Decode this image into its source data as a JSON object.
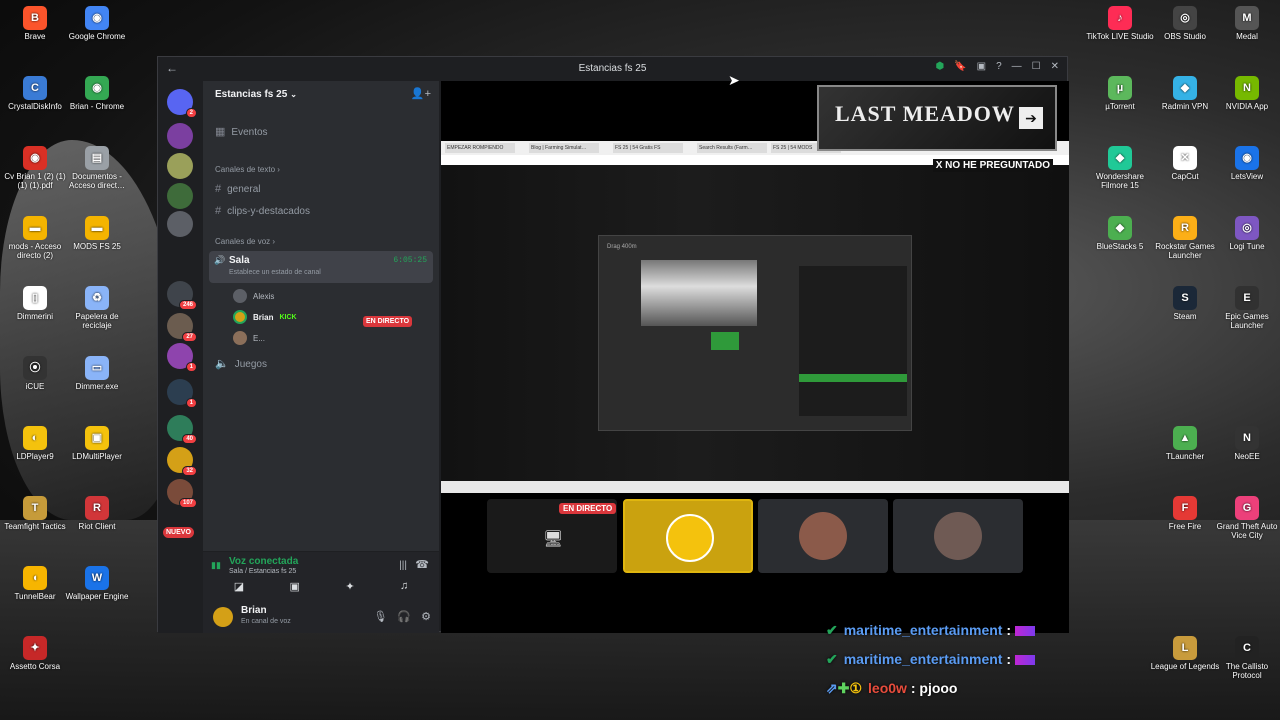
{
  "desktop": {
    "left_icons": [
      {
        "label": "Brave",
        "color": "#fb542b",
        "glyph": "B"
      },
      {
        "label": "Google Chrome",
        "color": "#4285f4",
        "glyph": "◉"
      },
      {
        "label": "CrystalDiskInfo",
        "color": "#3a7bd5",
        "glyph": "C"
      },
      {
        "label": "Brian - Chrome",
        "color": "#34a853",
        "glyph": "◉"
      },
      {
        "label": "Cv Brian 1 (2) (1) (1) (1).pdf",
        "color": "#d93025",
        "glyph": "◉"
      },
      {
        "label": "Documentos - Acceso direct…",
        "color": "#9aa0a6",
        "glyph": "▤"
      },
      {
        "label": "mods - Acceso directo (2)",
        "color": "#f4b400",
        "glyph": "▬"
      },
      {
        "label": "MODS FS 25",
        "color": "#f4b400",
        "glyph": "▬"
      },
      {
        "label": "Dimmerini",
        "color": "#ffffff",
        "glyph": "▯"
      },
      {
        "label": "Papelera de reciclaje",
        "color": "#8ab4f8",
        "glyph": "♻"
      },
      {
        "label": "iCUE",
        "color": "#333333",
        "glyph": "⦿"
      },
      {
        "label": "Dimmer.exe",
        "color": "#8ab4f8",
        "glyph": "▭"
      },
      {
        "label": "LDPlayer9",
        "color": "#f4c20d",
        "glyph": "◐"
      },
      {
        "label": "LDMultiPlayer",
        "color": "#f4c20d",
        "glyph": "▣"
      },
      {
        "label": "Teamfight Tactics",
        "color": "#c69b3a",
        "glyph": "T"
      },
      {
        "label": "Riot Client",
        "color": "#d13639",
        "glyph": "R"
      },
      {
        "label": "TunnelBear",
        "color": "#f7b500",
        "glyph": "◖"
      },
      {
        "label": "Wallpaper Engine",
        "color": "#1a73e8",
        "glyph": "W"
      },
      {
        "label": "Assetto Corsa",
        "color": "#c62828",
        "glyph": "✦"
      }
    ],
    "right_icons": [
      {
        "label": "TikTok LIVE Studio",
        "color": "#fe2c55",
        "glyph": "♪"
      },
      {
        "label": "OBS Studio",
        "color": "#444444",
        "glyph": "◎"
      },
      {
        "label": "Medal",
        "color": "#555555",
        "glyph": "M"
      },
      {
        "label": "µTorrent",
        "color": "#5cb85c",
        "glyph": "µ"
      },
      {
        "label": "Radmin VPN",
        "color": "#35b2e6",
        "glyph": "◆"
      },
      {
        "label": "NVIDIA App",
        "color": "#76b900",
        "glyph": "N"
      },
      {
        "label": "Wondershare Filmore 15",
        "color": "#20c997",
        "glyph": "◆"
      },
      {
        "label": "CapCut",
        "color": "#ffffff",
        "glyph": "✕"
      },
      {
        "label": "LetsView",
        "color": "#1a73e8",
        "glyph": "◉"
      },
      {
        "label": "BlueStacks 5",
        "color": "#4caf50",
        "glyph": "◆"
      },
      {
        "label": "Rockstar Games Launcher",
        "color": "#fcaf17",
        "glyph": "R"
      },
      {
        "label": "Logi Tune",
        "color": "#7e57c2",
        "glyph": "◎"
      },
      {
        "label": "Steam",
        "color": "#1b2838",
        "glyph": "S"
      },
      {
        "label": "Epic Games Launcher",
        "color": "#313131",
        "glyph": "E"
      },
      {
        "label": "TLauncher",
        "color": "#4caf50",
        "glyph": "▲"
      },
      {
        "label": "NeoEE",
        "color": "#333333",
        "glyph": "N"
      },
      {
        "label": "Free Fire",
        "color": "#e53935",
        "glyph": "F"
      },
      {
        "label": "Grand Theft Auto Vice City",
        "color": "#ec407a",
        "glyph": "G"
      },
      {
        "label": "League of Legends",
        "color": "#c89b3c",
        "glyph": "L"
      },
      {
        "label": "The Callisto Protocol",
        "color": "#222222",
        "glyph": "C"
      }
    ]
  },
  "window": {
    "title": "Estancias fs 25",
    "back": "←",
    "tb_icons": [
      "⬢",
      "🔖",
      "▣",
      "?",
      "—",
      "☐",
      "✕"
    ]
  },
  "guild_badges": [
    "2",
    "246",
    "27",
    "1",
    "1",
    "40",
    "32",
    "107"
  ],
  "guild_new": "NUEVO",
  "channels": {
    "server_name": "Estancias fs 25",
    "events": "Eventos",
    "text_category": "Canales de texto",
    "text_channels": [
      "general",
      "clips-y-destacados"
    ],
    "voice_category": "Canales de voz",
    "voice_channel": "Sala",
    "voice_status": "Establece un estado de canal",
    "voice_timer": "6:05:25",
    "users": [
      "Alexis",
      "Brian",
      "E..."
    ],
    "live_label": "EN DIRECTO",
    "kick_label": "KICK",
    "other_voice": "Juegos"
  },
  "voice": {
    "title": "Voz conectada",
    "sub": "Sala / Estancias fs 25"
  },
  "userpanel": {
    "name": "Brian",
    "sub": "En canal de voz"
  },
  "overlay": {
    "banner": "LAST MEADOW",
    "banner_sub": "X NO HE PREGUNTADO"
  },
  "stream": {
    "dialog_title": "Drag 400m",
    "tabs": [
      "EMPEZAR ROMPIENDO",
      "Blog | Farming Simulat…",
      "FS 25 | 54 Gratis FS",
      "Search Results (Farm…",
      "FS 25 | 54 MODS"
    ]
  },
  "tiles": {
    "live": "EN DIRECTO"
  },
  "chat": [
    {
      "name": "maritime_entertainment",
      "sep": ":",
      "msg": ""
    },
    {
      "name": "maritime_entertainment",
      "sep": ":",
      "msg": ""
    },
    {
      "name": "leo0w",
      "sep": ":",
      "msg": "pjooo"
    }
  ],
  "colors": {
    "discord_green": "#23a55a",
    "discord_red": "#da373c",
    "blurple": "#5865f2",
    "chat_name": "#5b9cf3",
    "leo_name": "#e74c3c"
  }
}
